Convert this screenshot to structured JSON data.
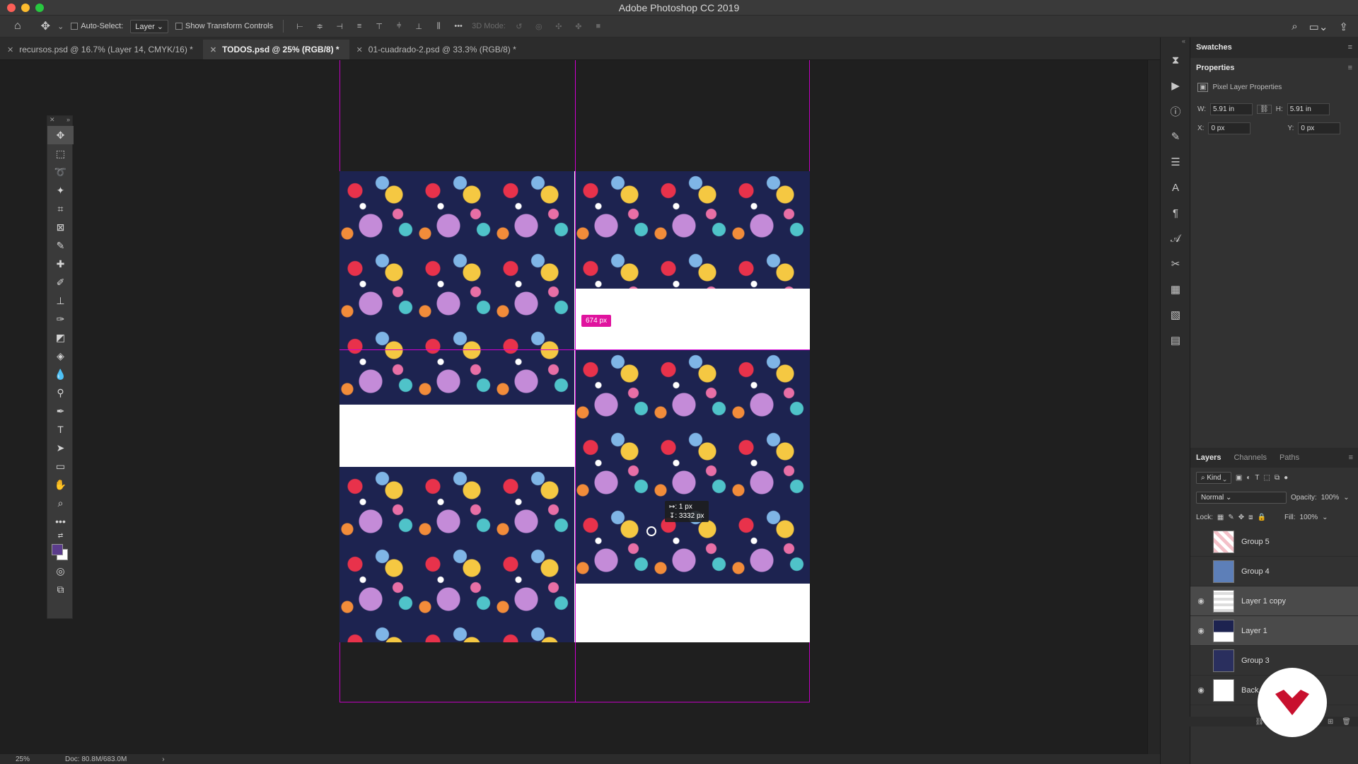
{
  "window": {
    "title": "Adobe Photoshop CC 2019",
    "traffic_colors": [
      "#fc5f57",
      "#fdbc2e",
      "#28c840"
    ]
  },
  "options_bar": {
    "auto_select_label": "Auto-Select:",
    "auto_select_value": "Layer",
    "show_transform_label": "Show Transform Controls",
    "mode_3d_label": "3D Mode:"
  },
  "tabs": [
    {
      "label": "recursos.psd @ 16.7% (Layer 14, CMYK/16) *",
      "active": false
    },
    {
      "label": "TODOS.psd @ 25% (RGB/8) *",
      "active": true
    },
    {
      "label": "01-cuadrado-2.psd @ 33.3% (RGB/8) *",
      "active": false
    }
  ],
  "canvas": {
    "measure_label": "674 px",
    "tooltip_line1": "↦:    1 px",
    "tooltip_line2": "↧: 3332 px",
    "guide_color": "#d300d3",
    "pattern_bg": "#1d2350"
  },
  "status": {
    "zoom": "25%",
    "doc": "Doc: 80.8M/683.0M",
    "arrow": "›"
  },
  "panels": {
    "swatches_title": "Swatches",
    "properties_title": "Properties",
    "pixel_layer_label": "Pixel Layer Properties",
    "w_label": "W:",
    "w_value": "5.91 in",
    "h_label": "H:",
    "h_value": "5.91 in",
    "x_label": "X:",
    "x_value": "0 px",
    "y_label": "Y:",
    "y_value": "0 px",
    "layers_tabs": [
      "Layers",
      "Channels",
      "Paths"
    ],
    "kind_label": "Kind",
    "blend_mode": "Normal",
    "opacity_label": "Opacity:",
    "opacity_value": "100%",
    "lock_label": "Lock:",
    "fill_label": "Fill:",
    "fill_value": "100%"
  },
  "layers": [
    {
      "name": "Group 5",
      "visible": false,
      "selected": false
    },
    {
      "name": "Group 4",
      "visible": false,
      "selected": false
    },
    {
      "name": "Layer 1 copy",
      "visible": true,
      "selected": true
    },
    {
      "name": "Layer 1",
      "visible": true,
      "selected": true
    },
    {
      "name": "Group 3",
      "visible": false,
      "selected": false
    },
    {
      "name": "Back",
      "visible": true,
      "selected": false
    }
  ],
  "accent": "#e0139e",
  "fg_color": "#5b3c8c"
}
